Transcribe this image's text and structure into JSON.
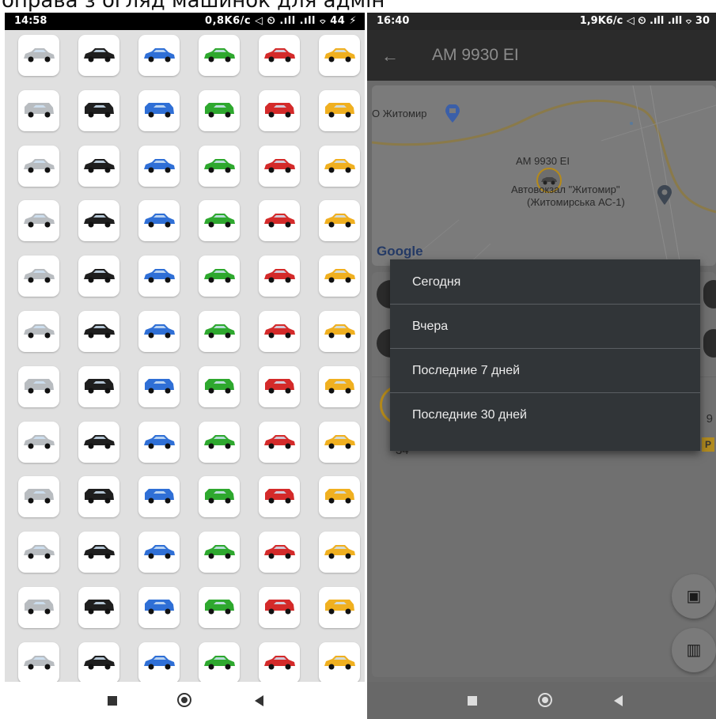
{
  "caption": "оправа з огляд машинок для адмін",
  "left": {
    "status_time": "14:58",
    "status_right": "0,8K6/c ◁ ⏲ .ıll .ıll ⌔ 44 ⚡",
    "grid_colors": [
      "#b8bcc0",
      "#1e1e1e",
      "#2f6fd6",
      "#2ea82e",
      "#d42a2a",
      "#f0b020"
    ],
    "grid_rows": 12
  },
  "right": {
    "status_time": "16:40",
    "status_right": "1,9K6/c ◁ ⏲ .ıll .ıll ⌔ 30",
    "title": "AM 9930 EI",
    "map": {
      "label_city": "О Житомир",
      "label_car": "AM 9930 EI",
      "label_station_1": "Автовокзал \"Житомир\"",
      "label_station_2": "(Житомирська АС-1)",
      "google": "Google"
    },
    "card_fragment_left": "34",
    "card_fragment_right": "9",
    "menu": {
      "items": [
        "Сегодня",
        "Вчера",
        "Последние 7 дней",
        "Последние 30 дней"
      ]
    }
  }
}
